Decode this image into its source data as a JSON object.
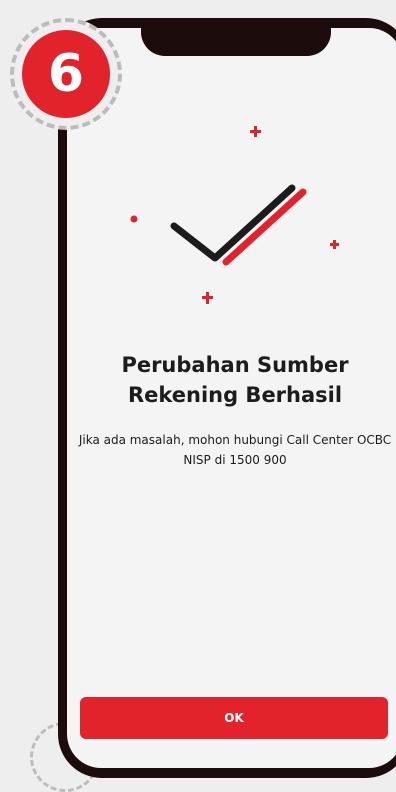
{
  "step_badge": {
    "number": "6"
  },
  "success": {
    "title": "Perubahan Sumber Rekening Berhasil",
    "message": "Jika ada masalah, mohon hubungi Call Center OCBC NISP di 1500 900"
  },
  "actions": {
    "ok_label": "OK"
  },
  "colors": {
    "accent": "#e2232b",
    "dark": "#1c0c0c",
    "screen_bg": "#f4f4f4",
    "page_bg": "#eeeeee"
  },
  "icons": {
    "success": "double-checkmark-icon",
    "sparkles": "plus-sparkle-icon"
  }
}
